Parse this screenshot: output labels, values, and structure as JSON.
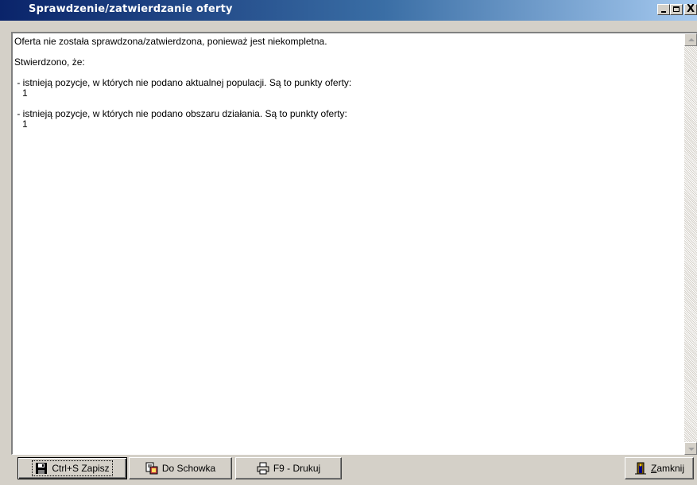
{
  "window": {
    "title": "Sprawdzenie/zatwierdzanie oferty",
    "controls": {
      "minimize": "_",
      "maximize": "□",
      "close": "X"
    }
  },
  "message": {
    "lines": [
      "Oferta nie została sprawdzona/zatwierdzona, ponieważ jest niekompletna.",
      "",
      "Stwierdzono, że:",
      "",
      " - istnieją pozycje, w których nie podano aktualnej populacji. Są to punkty oferty:",
      "   1",
      "",
      " - istnieją pozycje, w których nie podano obszaru działania. Są to punkty oferty:",
      "   1"
    ]
  },
  "toolbar": {
    "save_label": "Ctrl+S Zapisz",
    "clipboard_label": "Do Schowka",
    "print_label": "F9 - Drukuj",
    "close_label_underlined": "Z",
    "close_label_rest": "amknij"
  },
  "icons": {
    "save": "floppy-disk-icon",
    "clipboard": "clipboard-icon",
    "print": "printer-icon",
    "close": "door-exit-icon"
  },
  "colors": {
    "titlebar_start": "#0a246a",
    "titlebar_end": "#a6caf0",
    "face": "#d4d0c8"
  }
}
